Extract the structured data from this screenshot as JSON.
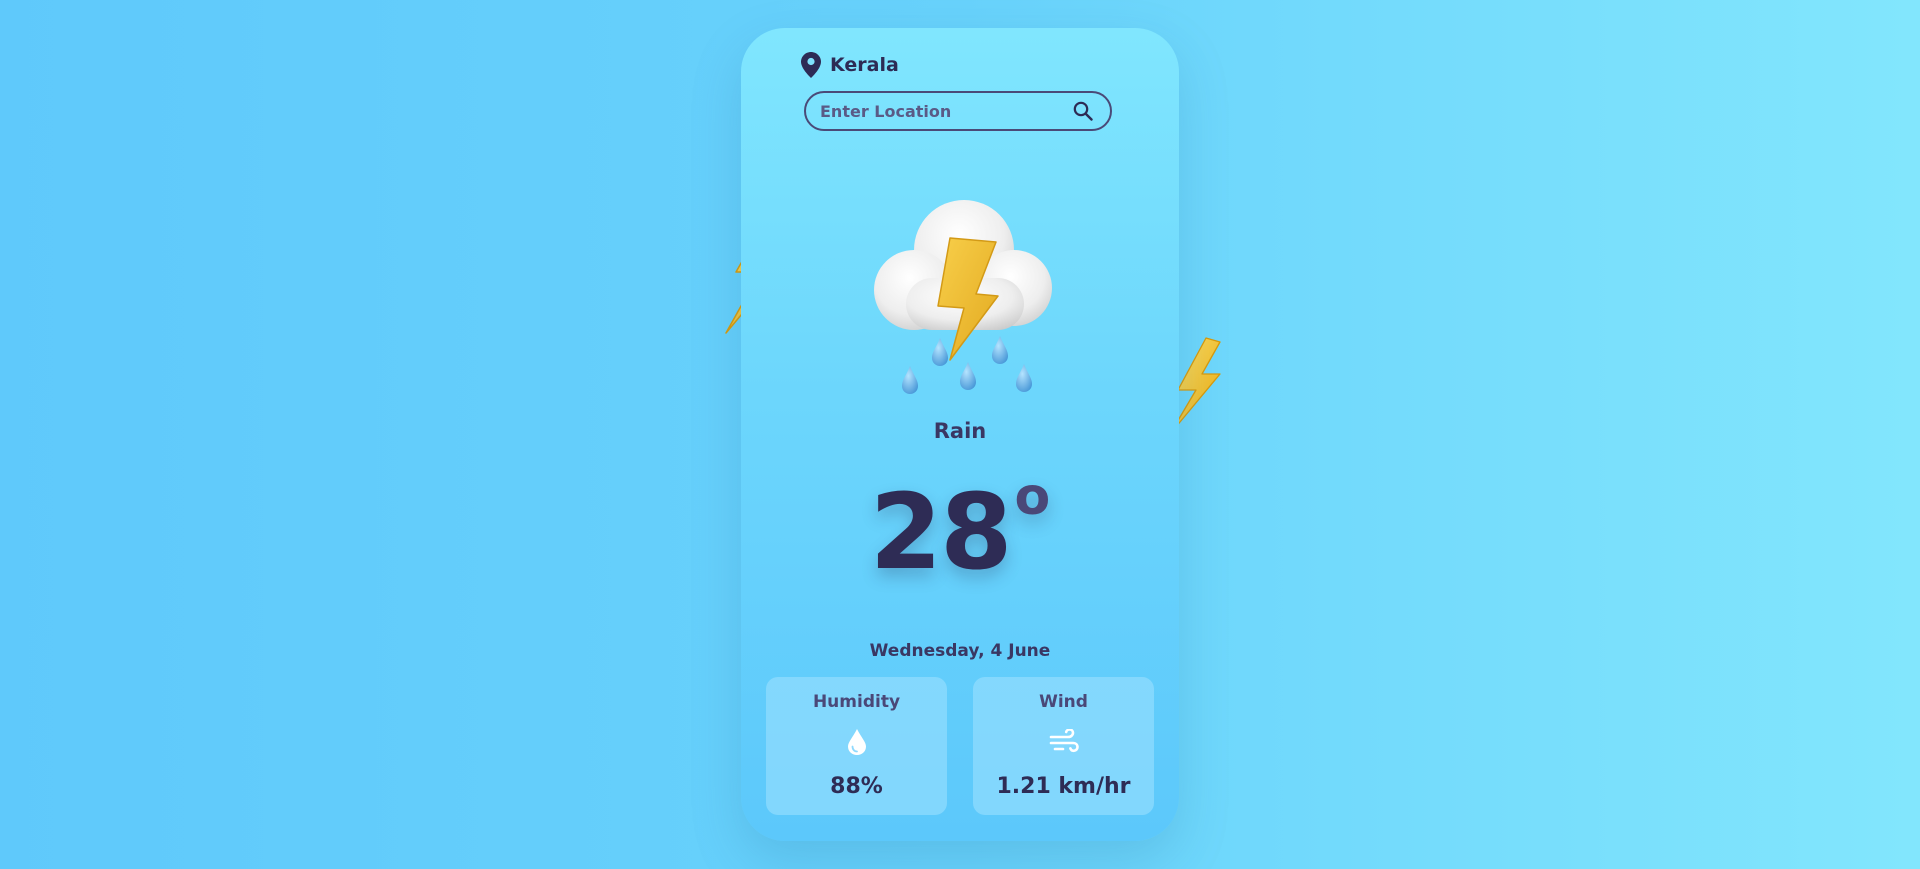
{
  "location": {
    "name": "Kerala",
    "icon": "map-pin-icon"
  },
  "search": {
    "placeholder": "Enter Location",
    "value": "",
    "icon": "search-icon"
  },
  "weather": {
    "icon": "thunderstorm-rain-icon",
    "condition": "Rain",
    "temperature": "28",
    "degree_symbol": "o",
    "date": "Wednesday, 4 June"
  },
  "stats": {
    "humidity": {
      "label": "Humidity",
      "value": "88%",
      "icon": "water-drop-icon"
    },
    "wind": {
      "label": "Wind",
      "value": "1.21 km/hr",
      "icon": "wind-icon"
    }
  },
  "colors": {
    "background": "#68d2fb",
    "card": "#72dcfd",
    "text_primary": "#2e2c55",
    "lightning": "#f5c518",
    "stat_card": "#8fd9fd"
  },
  "decorations": {
    "icon": "lightning-bolt-icon"
  }
}
